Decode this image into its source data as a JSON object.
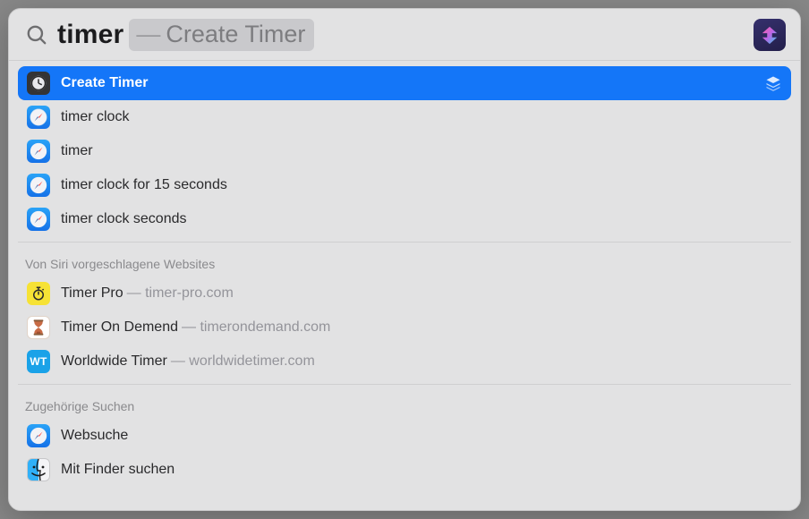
{
  "search": {
    "query": "timer",
    "suggestion_label": "Create Timer"
  },
  "sections": {
    "top": [
      {
        "icon": "clock-icon",
        "title": "Create Timer",
        "selected": true,
        "trailing": "stack"
      },
      {
        "icon": "safari-icon",
        "title": "timer clock"
      },
      {
        "icon": "safari-icon",
        "title": "timer"
      },
      {
        "icon": "safari-icon",
        "title": "timer clock for 15 seconds"
      },
      {
        "icon": "safari-icon",
        "title": "timer clock seconds"
      }
    ],
    "siri_header": "Von Siri vorgeschlagene Websites",
    "siri": [
      {
        "icon": "stopwatch-icon",
        "title": "Timer Pro",
        "sub": "timer-pro.com"
      },
      {
        "icon": "hourglass-icon",
        "title": "Timer On Demend",
        "sub": "timerondemand.com"
      },
      {
        "icon": "wt-icon",
        "title": "Worldwide Timer",
        "sub": "worldwidetimer.com"
      }
    ],
    "related_header": "Zugehörige Suchen",
    "related": [
      {
        "icon": "safari-icon",
        "title": "Websuche"
      },
      {
        "icon": "finder-icon",
        "title": "Mit Finder suchen"
      }
    ]
  }
}
